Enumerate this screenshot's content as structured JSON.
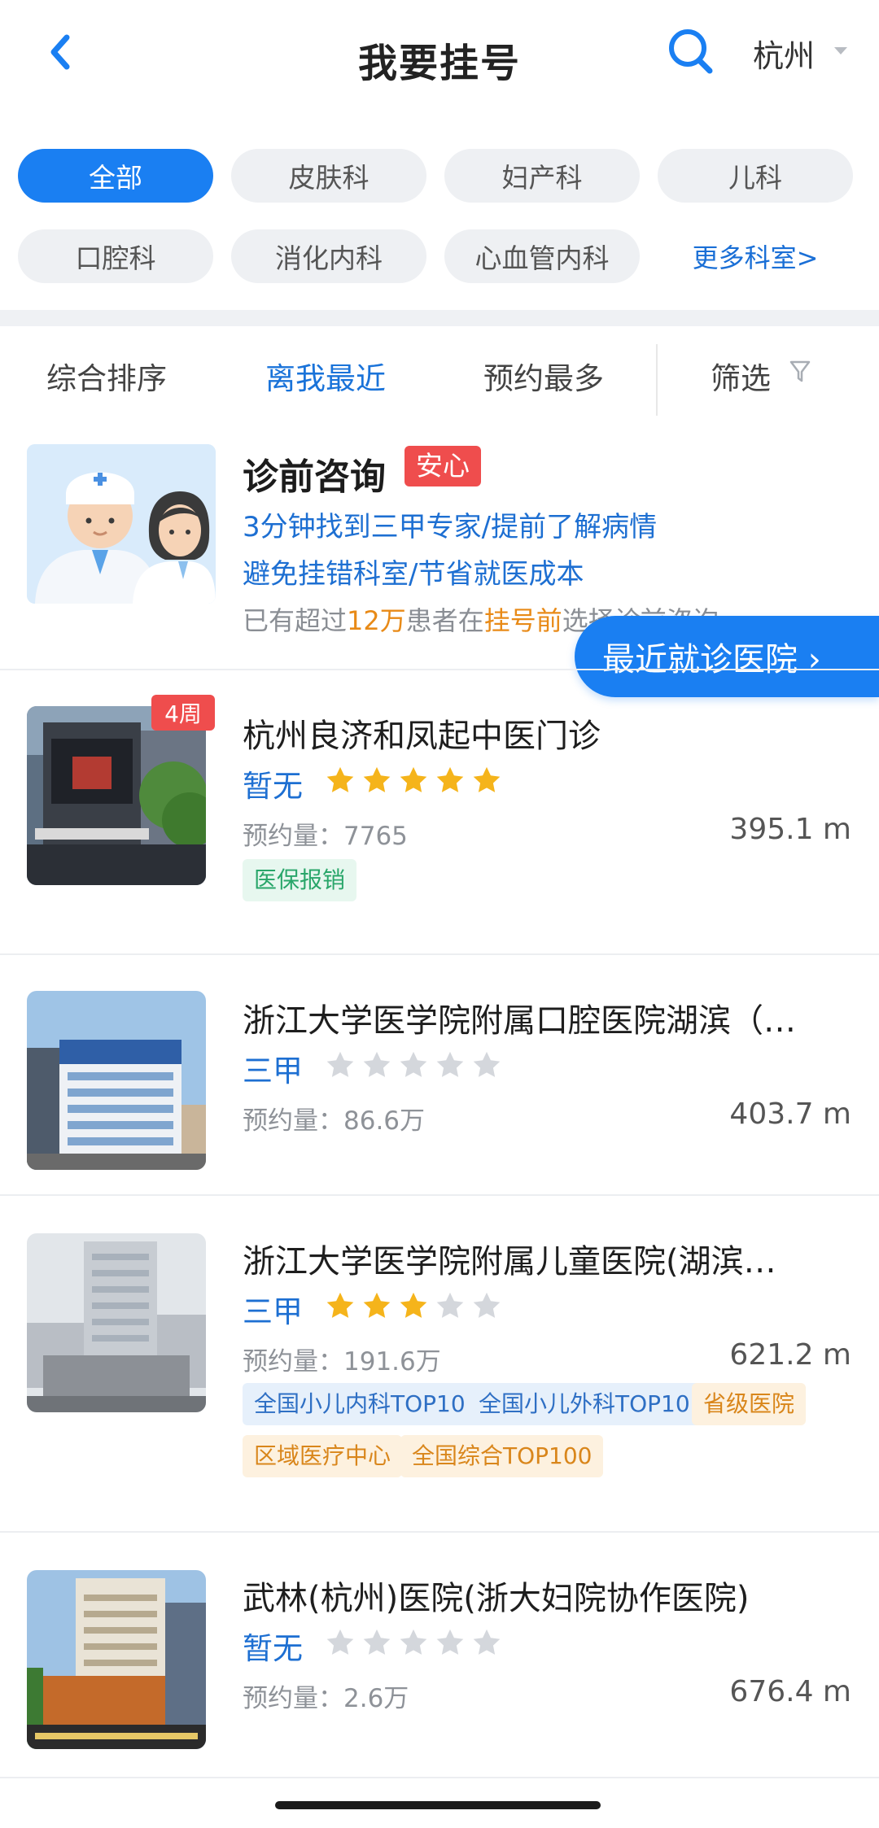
{
  "header": {
    "title": "我要挂号",
    "city": "杭州"
  },
  "departments": {
    "items": [
      "全部",
      "皮肤科",
      "妇产科",
      "儿科",
      "口腔科",
      "消化内科",
      "心血管内科"
    ],
    "more": "更多科室>"
  },
  "sort": {
    "items": [
      "综合排序",
      "离我最近",
      "预约最多"
    ],
    "active_index": 1,
    "filter": "筛选"
  },
  "consult": {
    "title": "诊前咨询",
    "tag": "安心",
    "line1": "3分钟找到三甲专家/提前了解病情",
    "line2": "避免挂错科室/节省就医成本",
    "note_prefix": "已有超过",
    "note_count": "12万",
    "note_mid": "患者在",
    "note_hl": "挂号前",
    "note_suffix": "选择诊前咨询"
  },
  "float_button": "最近就诊医院 ›",
  "hospitals": [
    {
      "name": "杭州良济和凤起中医门诊",
      "level": "暂无",
      "rating": 5,
      "count_label": "预约量：",
      "count": "7765",
      "distance": "395.1 m",
      "badge": "4周",
      "tags": [
        {
          "text": "医保报销",
          "color": "green"
        }
      ]
    },
    {
      "name": "浙江大学医学院附属口腔医院湖滨（…",
      "level": "三甲",
      "rating": 0,
      "count_label": "预约量：",
      "count": "86.6万",
      "distance": "403.7 m",
      "tags": []
    },
    {
      "name": "浙江大学医学院附属儿童医院(湖滨…",
      "level": "三甲",
      "rating": 3,
      "count_label": "预约量：",
      "count": "191.6万",
      "distance": "621.2 m",
      "tags": [
        {
          "text": "全国小儿内科TOP10",
          "color": "blue"
        },
        {
          "text": "全国小儿外科TOP10",
          "color": "blue"
        },
        {
          "text": "省级医院",
          "color": "orange"
        },
        {
          "text": "区域医疗中心",
          "color": "orange"
        },
        {
          "text": "全国综合TOP100",
          "color": "orange"
        }
      ]
    },
    {
      "name": "武林(杭州)医院(浙大妇院协作医院)",
      "level": "暂无",
      "rating": 0,
      "count_label": "预约量：",
      "count": "2.6万",
      "distance": "676.4 m",
      "tags": []
    }
  ],
  "colors": {
    "accent": "#1a7ff2",
    "star_on": "#f5b41b",
    "star_off": "#d4d7dc",
    "badge_red": "#ef4d4d"
  }
}
